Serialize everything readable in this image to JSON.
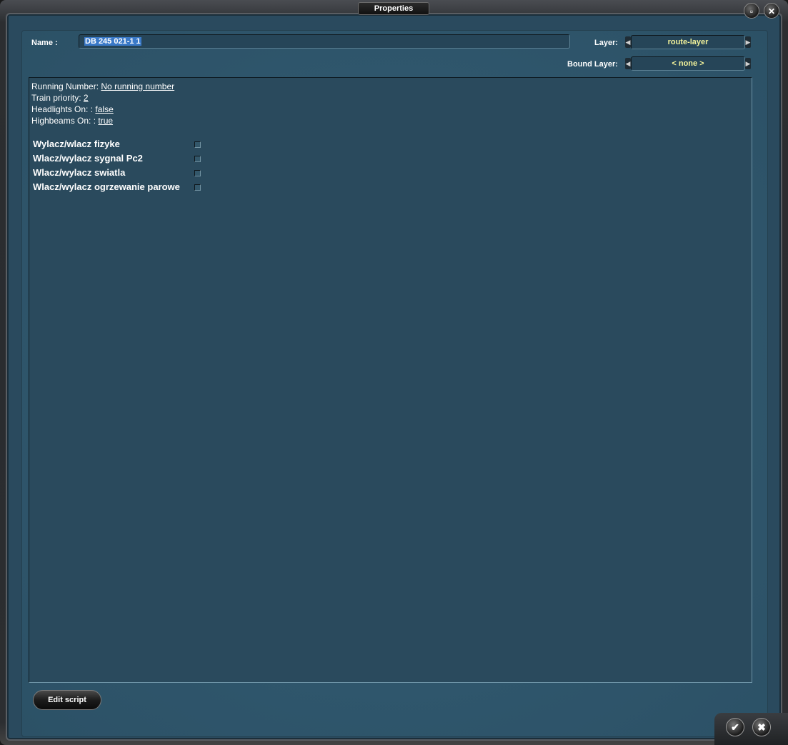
{
  "window": {
    "title": "Properties"
  },
  "header": {
    "name_label": "Name :",
    "name_value": "DB 245 021-1 1",
    "layer_label": "Layer:",
    "layer_value": "route-layer",
    "bound_layer_label": "Bound Layer:",
    "bound_layer_value": "< none >"
  },
  "properties": [
    {
      "label": "Running Number: ",
      "value": "No running number"
    },
    {
      "label": "Train priority: ",
      "value": "2"
    },
    {
      "label": "Headlights On: : ",
      "value": "false"
    },
    {
      "label": "Highbeams On: : ",
      "value": "true"
    }
  ],
  "options": [
    {
      "label": "Wylacz/wlacz fizyke",
      "checked": false
    },
    {
      "label": "Wlacz/wylacz sygnal Pc2",
      "checked": false
    },
    {
      "label": "Wlacz/wylacz swiatla",
      "checked": false
    },
    {
      "label": "Wlacz/wylacz ogrzewanie parowe",
      "checked": false
    }
  ],
  "footer": {
    "edit_script_label": "Edit script"
  },
  "icons": {
    "restore": "restore-icon",
    "close": "close-icon",
    "ok": "checkmark-icon",
    "cancel": "cancel-icon"
  },
  "colors": {
    "panel": "#2f566c",
    "content": "#2a4a5d",
    "select_text": "#f2f29a",
    "selection": "#3a79c8"
  }
}
